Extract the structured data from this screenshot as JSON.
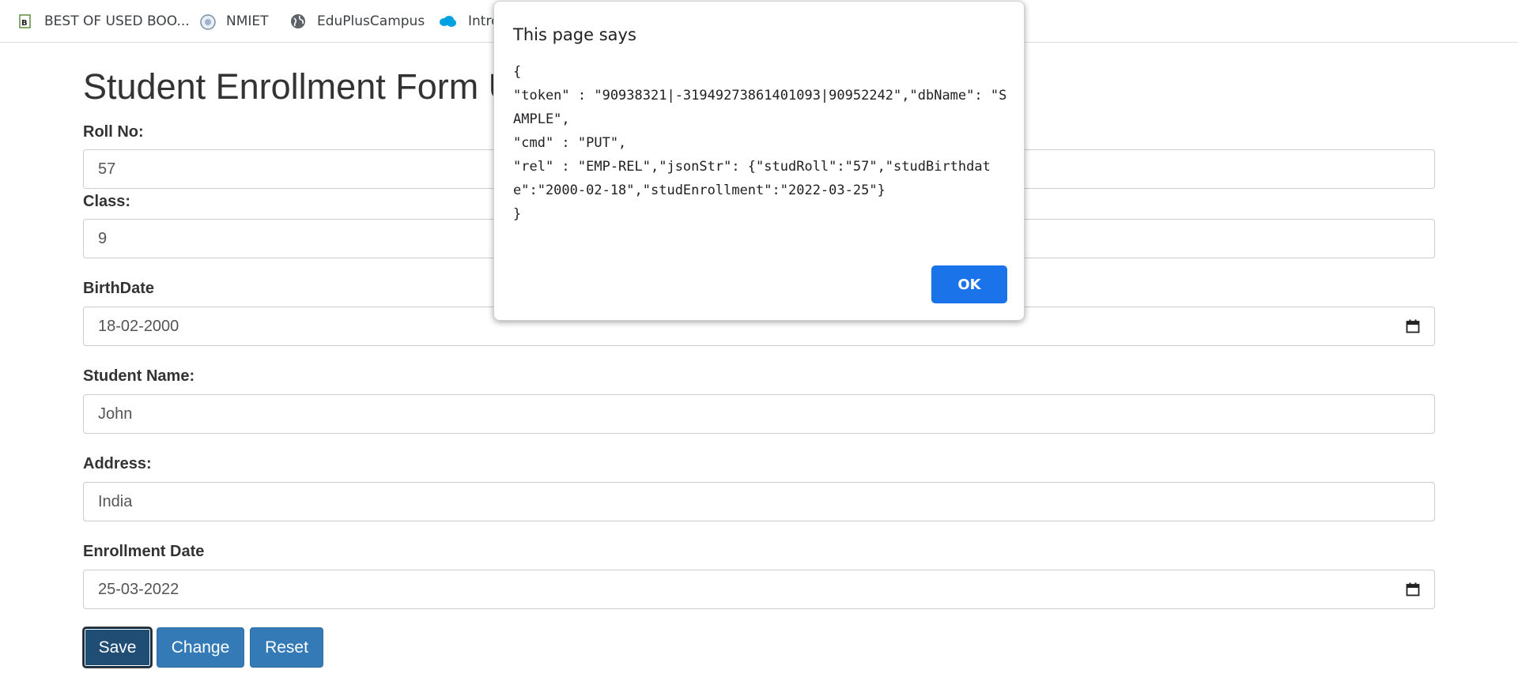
{
  "bookmarks": [
    {
      "label": "BEST OF USED BOO...",
      "icon": "book-logo-icon"
    },
    {
      "label": "NMIET",
      "icon": "college-logo-icon"
    },
    {
      "label": "EduPlusCampus",
      "icon": "globe-icon"
    },
    {
      "label": "Intro",
      "icon": "salesforce-cloud-icon"
    }
  ],
  "form": {
    "title": "Student Enrollment Form U",
    "fields": [
      {
        "label": "Roll No:",
        "value": "57"
      },
      {
        "label": "Class:",
        "value": "9"
      },
      {
        "label": "BirthDate",
        "value": "18-02-2000"
      },
      {
        "label": "Student Name:",
        "value": "John"
      },
      {
        "label": "Address:",
        "value": "India"
      },
      {
        "label": "Enrollment Date",
        "value": "25-03-2022"
      }
    ],
    "buttons": {
      "save": "Save",
      "change": "Change",
      "reset": "Reset"
    }
  },
  "dialog": {
    "title": "This page says",
    "message": "{\n\"token\" : \"90938321|-31949273861401093|90952242\",\"dbName\": \"SAMPLE\",\n\"cmd\" : \"PUT\",\n\"rel\" : \"EMP-REL\",\"jsonStr\": {\"studRoll\":\"57\",\"studBirthdate\":\"2000-02-18\",\"studEnrollment\":\"2022-03-25\"}\n}",
    "ok_label": "OK"
  },
  "colors": {
    "primary_button": "#337ab7",
    "active_button": "#204d74",
    "dialog_ok": "#1a73e8"
  }
}
